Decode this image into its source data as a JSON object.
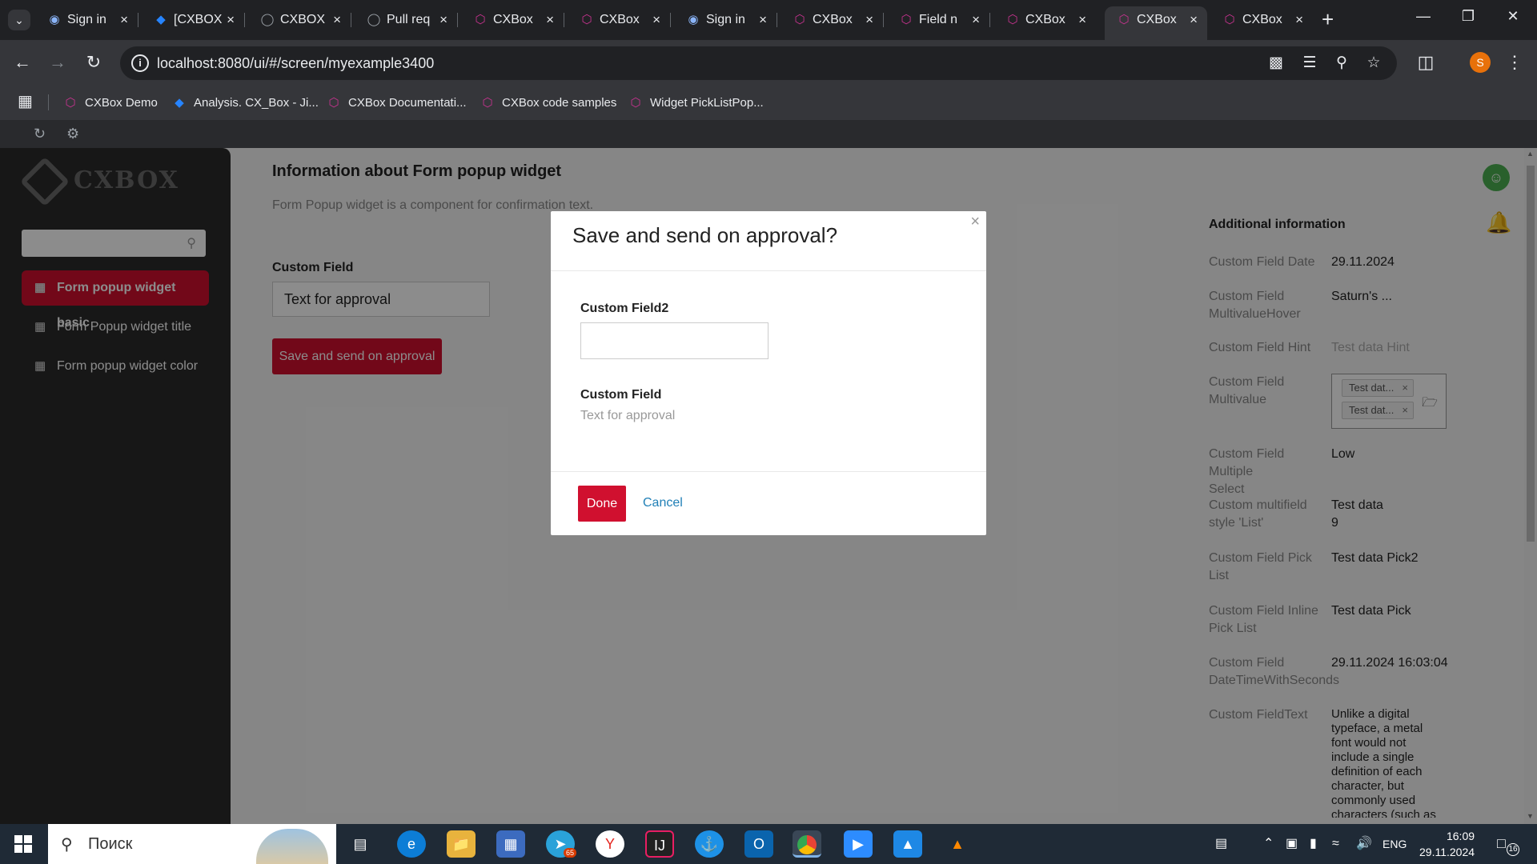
{
  "browser": {
    "tabs": [
      {
        "title": "Sign in",
        "icon": "sign-in-icon"
      },
      {
        "title": "[CXBOX",
        "icon": "jira-icon"
      },
      {
        "title": "CXBOX",
        "icon": "github-icon"
      },
      {
        "title": "Pull req",
        "icon": "github-icon"
      },
      {
        "title": "CXBox",
        "icon": "cxbox-icon"
      },
      {
        "title": "CXBox",
        "icon": "cxbox-icon"
      },
      {
        "title": "Sign in",
        "icon": "sign-in-icon"
      },
      {
        "title": "CXBox",
        "icon": "cxbox-icon"
      },
      {
        "title": "Field n",
        "icon": "cxbox-icon"
      },
      {
        "title": "CXBox",
        "icon": "cxbox-icon"
      },
      {
        "title": "CXBox",
        "icon": "cxbox-icon",
        "active": true
      },
      {
        "title": "CXBox",
        "icon": "cxbox-icon"
      }
    ],
    "url": "localhost:8080/ui/#/screen/myexample3400",
    "profile_initial": "S",
    "bookmarks": [
      {
        "label": "CXBox Demo",
        "icon": "cxbox-icon"
      },
      {
        "label": "Analysis. CX_Box - Ji...",
        "icon": "jira-icon"
      },
      {
        "label": "CXBox Documentati...",
        "icon": "cxbox-icon"
      },
      {
        "label": "CXBox code samples",
        "icon": "cxbox-icon"
      },
      {
        "label": "Widget PickListPop...",
        "icon": "cxbox-icon"
      }
    ]
  },
  "app": {
    "logo_text": "CXBOX",
    "menu": [
      {
        "label": "Form popup widget basic",
        "active": true
      },
      {
        "label": "Form Popup widget title",
        "active": false
      },
      {
        "label": "Form popup widget color",
        "active": false
      }
    ],
    "main": {
      "title": "Information about Form popup widget",
      "subtitle": "Form Popup widget is a component for confirmation text.",
      "field_label": "Custom Field",
      "field_value": "Text for approval",
      "action_button": "Save and send on approval"
    },
    "additional": {
      "title": "Additional information",
      "rows": [
        {
          "label": "Custom Field Date",
          "value": "29.11.2024"
        },
        {
          "label": "Custom Field MultivalueHover",
          "value": "Saturn's ..."
        },
        {
          "label": "Custom Field Hint",
          "value": "Test data Hint"
        },
        {
          "label": "Custom Field Multivalue",
          "tags": [
            "Test dat...",
            "Test dat..."
          ]
        },
        {
          "label": "Custom Field Multiple Select",
          "value": "Low"
        },
        {
          "label": "Custom multifield style 'List'",
          "value": "Test data 9"
        },
        {
          "label": "Custom Field Pick List",
          "value": "Test data Pick2"
        },
        {
          "label": "Custom Field Inline Pick List",
          "value": "Test data Pick"
        },
        {
          "label": "Custom Field DateTimeWithSeconds",
          "value": "29.11.2024 16:03:04"
        },
        {
          "label": "Custom FieldText",
          "value": "Unlike a digital typeface, a metal font would not include a single definition of each character, but commonly used characters (such as"
        }
      ]
    }
  },
  "modal": {
    "title": "Save and send on approval?",
    "field2_label": "Custom Field2",
    "field2_value": "",
    "field_label": "Custom Field",
    "field_value": "Text for approval",
    "done": "Done",
    "cancel": "Cancel"
  },
  "taskbar": {
    "search_placeholder": "Поиск",
    "telegram_badge": "65",
    "language": "ENG",
    "time": "16:09",
    "date": "29.11.2024",
    "notifications": "16"
  }
}
